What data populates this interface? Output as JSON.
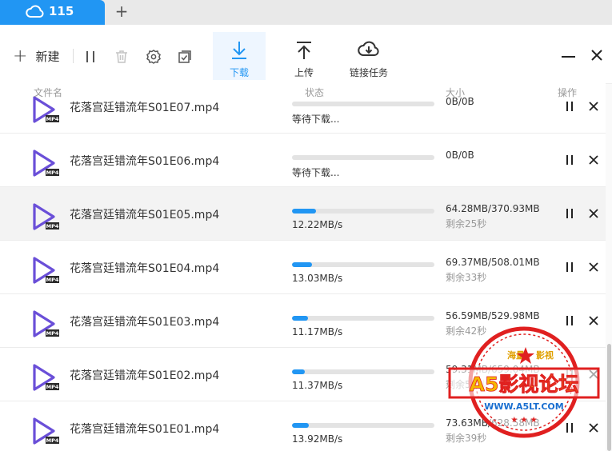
{
  "tabbar": {
    "active_tab": {
      "icon": "cloud-icon",
      "title": "115"
    },
    "new_tab_icon": "plus-icon"
  },
  "toolbar": {
    "new_label": "新建",
    "icons": [
      "pause-icon",
      "trash-icon",
      "gear-icon",
      "check-square-icon"
    ],
    "tabs": [
      {
        "label": "下载",
        "icon": "download-icon",
        "active": true
      },
      {
        "label": "上传",
        "icon": "upload-icon",
        "active": false
      },
      {
        "label": "链接任务",
        "icon": "cloud-download-icon",
        "active": false
      }
    ]
  },
  "columns": {
    "name": "文件名",
    "status": "状态",
    "size": "大小",
    "action": "操作"
  },
  "rows": [
    {
      "name": "花落宫廷错流年S01E07.mp4",
      "progress": 0,
      "status": "等待下载...",
      "size": "0B/0B",
      "remain": ""
    },
    {
      "name": "花落宫廷错流年S01E06.mp4",
      "progress": 0,
      "status": "等待下载...",
      "size": "0B/0B",
      "remain": ""
    },
    {
      "name": "花落宫廷错流年S01E05.mp4",
      "progress": 0.17,
      "status": "12.22MB/s",
      "size": "64.28MB/370.93MB",
      "remain": "剩余25秒"
    },
    {
      "name": "花落宫廷错流年S01E04.mp4",
      "progress": 0.14,
      "status": "13.03MB/s",
      "size": "69.37MB/508.01MB",
      "remain": "剩余33秒"
    },
    {
      "name": "花落宫廷错流年S01E03.mp4",
      "progress": 0.11,
      "status": "11.17MB/s",
      "size": "56.59MB/529.98MB",
      "remain": "剩余42秒"
    },
    {
      "name": "花落宫廷错流年S01E02.mp4",
      "progress": 0.09,
      "status": "11.37MB/s",
      "size": "59.31MB/659.04MB",
      "remain": "剩余51秒"
    },
    {
      "name": "花落宫廷错流年S01E01.mp4",
      "progress": 0.12,
      "status": "13.92MB/s",
      "size": "73.63MB/628.58MB",
      "remain": "剩余39秒"
    }
  ],
  "watermark": {
    "top": "海量",
    "top2": "影视",
    "main": "A5影视论坛",
    "url": "WWW.A5LT.COM"
  },
  "colors": {
    "accent": "#2196f3",
    "file_icon": "#6a4fd8",
    "stamp": "#e02020"
  }
}
